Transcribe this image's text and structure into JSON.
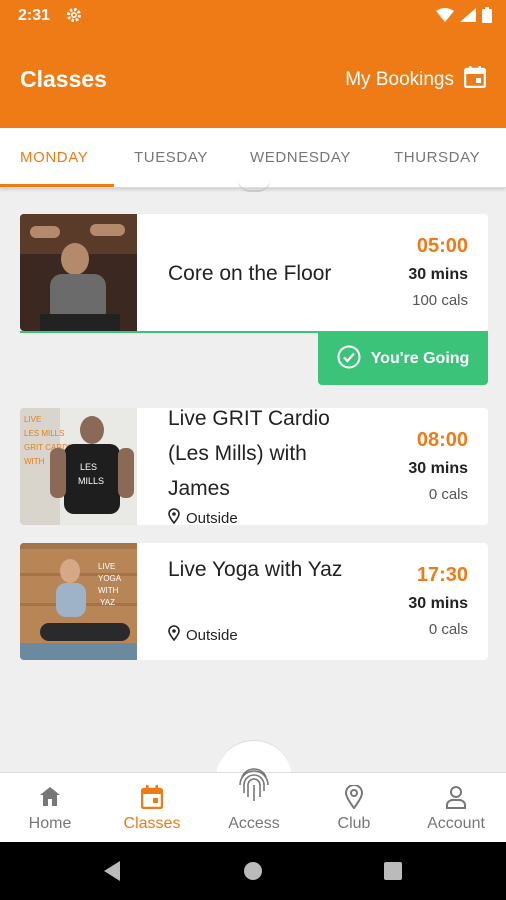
{
  "status": {
    "time": "2:31"
  },
  "header": {
    "title": "Classes",
    "bookings_label": "My Bookings"
  },
  "tabs": [
    {
      "label": "MONDAY",
      "active": true
    },
    {
      "label": "TUESDAY"
    },
    {
      "label": "WEDNESDAY"
    },
    {
      "label": "THURSDAY"
    }
  ],
  "classes": [
    {
      "title": "Core on the Floor",
      "time": "05:00",
      "duration": "30 mins",
      "cals": "100 cals",
      "going": "You're Going"
    },
    {
      "title": "Live GRIT Cardio (Les Mills) with James",
      "time": "08:00",
      "duration": "30 mins",
      "cals": "0 cals",
      "location": "Outside"
    },
    {
      "title": "Live Yoga with Yaz",
      "time": "17:30",
      "duration": "30 mins",
      "cals": "0 cals",
      "location": "Outside"
    }
  ],
  "bottom_nav": [
    {
      "label": "Home"
    },
    {
      "label": "Classes",
      "active": true
    },
    {
      "label": "Access"
    },
    {
      "label": "Club"
    },
    {
      "label": "Account"
    }
  ],
  "colors": {
    "accent": "#ee7b16",
    "going": "#3cc37a"
  }
}
